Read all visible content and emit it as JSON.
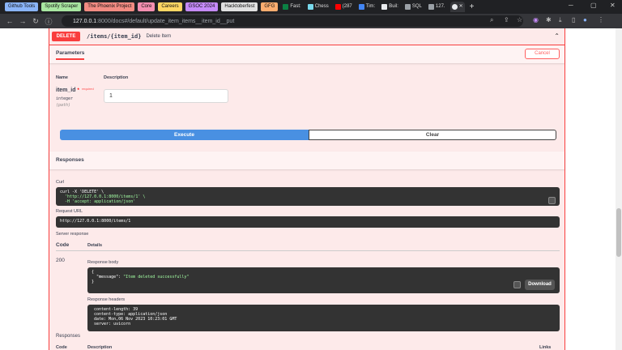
{
  "bookmarks": [
    {
      "label": "Github Tools",
      "color": "#8ab4f8"
    },
    {
      "label": "Spotify Scraper",
      "color": "#a8e6a1"
    },
    {
      "label": "The Phoenix Project",
      "color": "#f28b82"
    },
    {
      "label": "Core",
      "color": "#f48fb1"
    },
    {
      "label": "Careers",
      "color": "#fdd663"
    },
    {
      "label": "GSOC 2024",
      "color": "#c58af9"
    },
    {
      "label": "Hacktoberfest",
      "color": "#e0e0e0"
    },
    {
      "label": "GFG",
      "color": "#fcad70"
    }
  ],
  "tabs": [
    {
      "label": "Fast:",
      "color": "#0b8043"
    },
    {
      "label": "Chess",
      "color": "#78d9ec"
    },
    {
      "label": "(287",
      "color": "#ff0000"
    },
    {
      "label": "Tim:",
      "color": "#4285f4"
    },
    {
      "label": "Buil:",
      "color": "#e8eaed"
    },
    {
      "label": "SQL",
      "color": "#9aa0a6"
    },
    {
      "label": "127.",
      "color": "#9aa0a6"
    }
  ],
  "address": {
    "host": "127.0.0.1",
    "path": ":8000/docs#/default/update_item_items__item_id__put"
  },
  "operation": {
    "method": "DELETE",
    "path": "/items/{item_id}",
    "summary": "Delete Item"
  },
  "parameters": {
    "tab_label": "Parameters",
    "cancel_label": "Cancel",
    "col_name": "Name",
    "col_description": "Description",
    "param_name": "item_id",
    "param_star": "*",
    "param_required": "required",
    "param_type": "integer",
    "param_in": "(path)",
    "param_value": "1"
  },
  "actions": {
    "execute": "Execute",
    "clear": "Clear"
  },
  "responses": {
    "title": "Responses",
    "curl_label": "Curl",
    "curl_l1": "curl -X 'DELETE' \\",
    "curl_l2": "  'http://127.0.0.1:8000/items/1' \\",
    "curl_l3": "  -H 'accept: application/json'",
    "request_url_label": "Request URL",
    "request_url": "http://127.0.0.1:8000/items/1",
    "server_response_label": "Server response",
    "col_code": "Code",
    "col_details": "Details",
    "code": "200",
    "body_label": "Response body",
    "body_open": "{",
    "body_key": "  \"message\": ",
    "body_value": "\"Item deleted successfully\"",
    "body_close": "}",
    "download_label": "Download",
    "headers_label": "Response headers",
    "headers": [
      "content-length: 39",
      "content-type: application/json",
      "date: Mon,06 Nov 2023 10:23:01 GMT",
      "server: uvicorn"
    ],
    "bottom_title": "Responses",
    "bottom_code": "Code",
    "bottom_description": "Description",
    "bottom_links": "Links"
  }
}
